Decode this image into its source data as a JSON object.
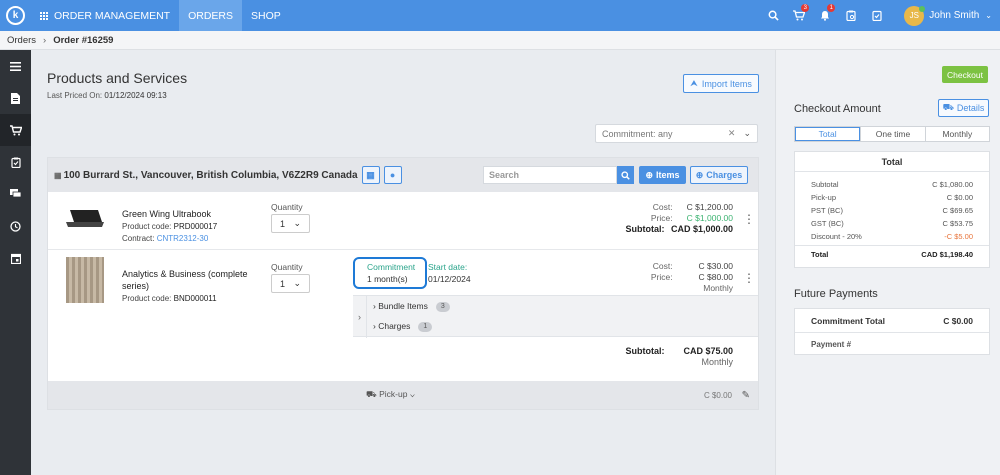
{
  "topbar": {
    "logo_letter": "k",
    "app_label": "ORDER MANAGEMENT",
    "tab_orders": "ORDERS",
    "tab_shop": "SHOP",
    "cart_badge": "3",
    "bell_badge": "1",
    "user_name": "John Smith",
    "user_initials": "JS"
  },
  "breadcrumb": {
    "root": "Orders",
    "current": "Order #16259"
  },
  "main": {
    "title": "Products and Services",
    "last_priced_label": "Last Priced On:",
    "last_priced_value": "01/12/2024 09:13",
    "import_button": "Import Items",
    "commitment_filter": "Commitment: any",
    "address": "100 Burrard St., Vancouver, British Columbia, V6Z2R9 Canada",
    "search_placeholder": "Search",
    "items_button": "Items",
    "charges_button": "Charges",
    "product1": {
      "name": "Green Wing Ultrabook",
      "code_label": "Product code:",
      "code": "PRD000017",
      "contract_label": "Contract:",
      "contract": "CNTR2312-30",
      "qty_label": "Quantity",
      "qty": "1",
      "cost_label": "Cost:",
      "cost": "C $1,200.00",
      "price_label": "Price:",
      "price": "C $1,000.00",
      "subtotal_label": "Subtotal:",
      "subtotal": "CAD $1,000.00"
    },
    "product2": {
      "name": "Analytics & Business (complete series)",
      "code_label": "Product code:",
      "code": "BND000011",
      "qty_label": "Quantity",
      "qty": "1",
      "commitment_label": "Commitment",
      "commitment_value": "1 month(s)",
      "start_label": "Start date:",
      "start_value": "01/12/2024",
      "cost_label": "Cost:",
      "cost": "C $30.00",
      "price_label": "Price:",
      "price": "C $80.00",
      "period": "Monthly",
      "bundle_label": "Bundle Items",
      "bundle_count": "3",
      "charges_label": "Charges",
      "charges_count": "1",
      "subtotal_label": "Subtotal:",
      "subtotal": "CAD $75.00",
      "subtotal_period": "Monthly"
    },
    "footer": {
      "shipping": "Pick-up",
      "amount": "C $0.00"
    }
  },
  "right": {
    "checkout_button": "Checkout",
    "checkout_amount_title": "Checkout Amount",
    "details_button": "Details",
    "tabs": [
      "Total",
      "One time",
      "Monthly"
    ],
    "total_header": "Total",
    "lines": [
      {
        "label": "Subtotal",
        "value": "C $1,080.00"
      },
      {
        "label": "Pick-up",
        "value": "C $0.00"
      },
      {
        "label": "PST (BC)",
        "value": "C $69.65"
      },
      {
        "label": "GST (BC)",
        "value": "C $53.75"
      },
      {
        "label": "Discount - 20%",
        "value": "-C $5.00"
      }
    ],
    "total_label": "Total",
    "total_value": "CAD $1,198.40",
    "future_title": "Future Payments",
    "commitment_total_label": "Commitment Total",
    "commitment_total_value": "C $0.00",
    "payment_label": "Payment #"
  },
  "colors": {
    "primary": "#4a90e2",
    "checkout": "#7cc242",
    "discount": "#e8743b",
    "green": "#3cb371"
  }
}
